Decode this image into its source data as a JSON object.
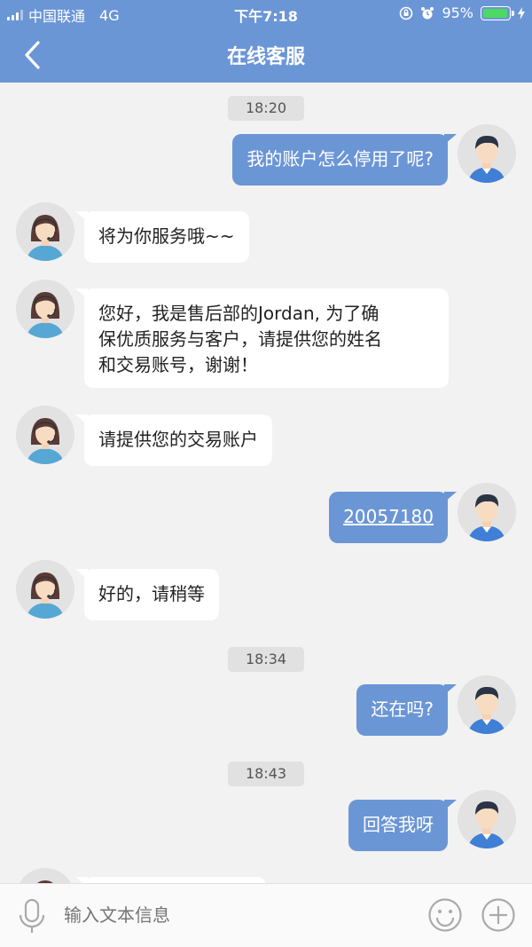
{
  "status": {
    "carrier": "中国联通",
    "network": "4G",
    "time": "下午7:18",
    "battery": "95%",
    "battery_level": 0.95
  },
  "nav": {
    "title": "在线客服"
  },
  "messages": [
    {
      "type": "time",
      "text": "18:20"
    },
    {
      "type": "out",
      "text": "我的账户怎么停用了呢?"
    },
    {
      "type": "in",
      "text": "将为你服务哦~~"
    },
    {
      "type": "in",
      "lines": [
        "您好，我是售后部的Jordan, 为了确",
        "保优质服务与客户，请提供您的姓名",
        "和交易账号，谢谢！"
      ]
    },
    {
      "type": "in",
      "text": "请提供您的交易账户"
    },
    {
      "type": "out",
      "text": "20057180"
    },
    {
      "type": "in",
      "text": "好的，请稍等"
    },
    {
      "type": "time",
      "text": "18:34"
    },
    {
      "type": "out",
      "text": "还在吗?"
    },
    {
      "type": "time",
      "text": "18:43"
    },
    {
      "type": "out",
      "text": "回答我呀"
    }
  ],
  "input": {
    "placeholder": "输入文本信息"
  },
  "colors": {
    "header": "#6b96d6",
    "bubble_out": "#6b96d6",
    "bubble_in": "#ffffff",
    "background": "#f2f2f2"
  }
}
